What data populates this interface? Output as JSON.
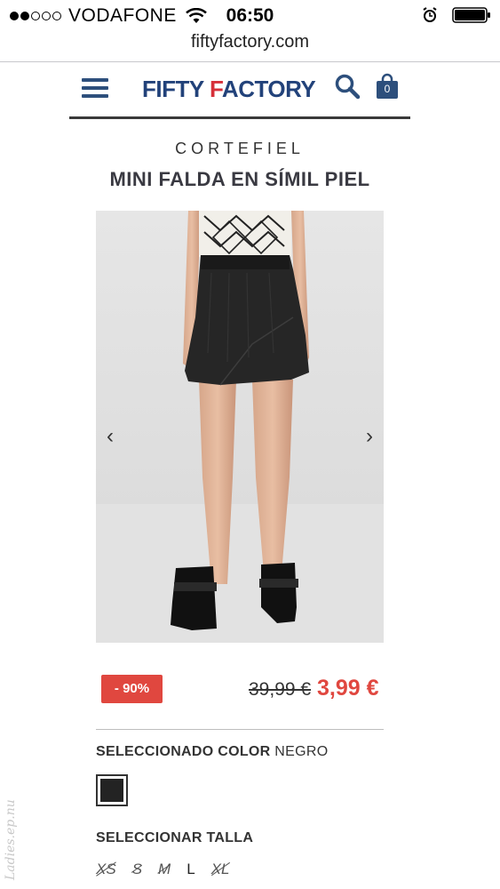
{
  "status_bar": {
    "carrier": "VODAFONE",
    "time": "06:50"
  },
  "browser": {
    "url": "fiftyfactory.com"
  },
  "header": {
    "logo_part1": "FIFTY ",
    "logo_part2": "F",
    "logo_part3": "ACTORY",
    "cart_count": "0"
  },
  "product": {
    "brand": "CORTEFIEL",
    "title": "MINI FALDA EN SÍMIL PIEL",
    "discount": "- 90%",
    "price_old": "39,99 €",
    "price_new": "3,99 €",
    "carousel_prev": "‹",
    "carousel_next": "›"
  },
  "color": {
    "heading": "SELECCIONADO COLOR",
    "value": "NEGRO",
    "swatch_color": "#232323"
  },
  "size": {
    "heading": "SELECCIONAR TALLA",
    "options": [
      {
        "label": "XS",
        "available": false
      },
      {
        "label": "S",
        "available": false
      },
      {
        "label": "M",
        "available": false
      },
      {
        "label": "L",
        "available": true
      },
      {
        "label": "XL",
        "available": false
      }
    ]
  },
  "watermark": "Ladies.ep.nu",
  "colors": {
    "brand_blue": "#22427a",
    "brand_red": "#d6303a",
    "sale_red": "#e0473f"
  }
}
